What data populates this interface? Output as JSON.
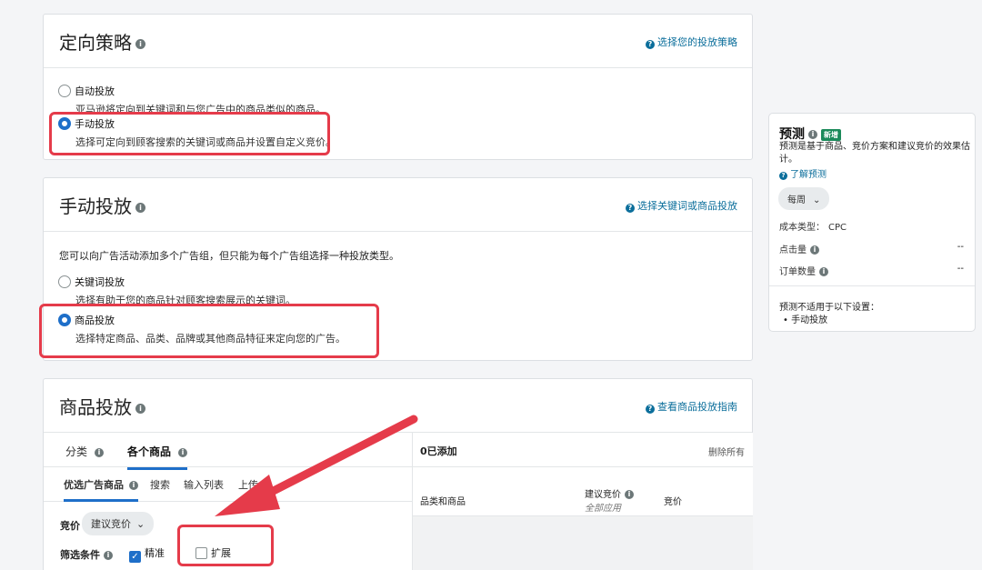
{
  "strategy": {
    "title": "定向策略",
    "help_link": "选择您的投放策略",
    "options": [
      {
        "label": "自动投放",
        "desc": "亚马逊将定向到关键词和与您广告中的商品类似的商品。",
        "selected": false
      },
      {
        "label": "手动投放",
        "desc": "选择可定向到顾客搜索的关键词或商品并设置自定义竞价。",
        "selected": true
      }
    ]
  },
  "manual": {
    "title": "手动投放",
    "help_link": "选择关键词或商品投放",
    "note": "您可以向广告活动添加多个广告组，但只能为每个广告组选择一种投放类型。",
    "options": [
      {
        "label": "关键词投放",
        "desc": "选择有助于您的商品针对顾客搜索展示的关键词。",
        "selected": false
      },
      {
        "label": "商品投放",
        "desc": "选择特定商品、品类、品牌或其他商品特征来定向您的广告。",
        "selected": true
      }
    ]
  },
  "product_targeting": {
    "title": "商品投放",
    "help_link": "查看商品投放指南",
    "tabs": [
      "分类",
      "各个商品"
    ],
    "subtabs": [
      "优选广告商品",
      "搜索",
      "输入列表",
      "上传"
    ],
    "bid_label": "竞价",
    "bid_value": "建议竞价",
    "filter_label": "筛选条件",
    "filter_exact": "精准",
    "filter_expand": "扩展",
    "added_label": "0已添加",
    "remove_all": "删除所有",
    "col_product": "品类和商品",
    "col_suggested": "建议竞价",
    "col_apply_all": "全部应用",
    "col_bid": "竞价"
  },
  "forecast": {
    "title": "预测",
    "badge": "新增",
    "desc": "预测是基于商品、竞价方案和建议竞价的效果估计。",
    "learn_more": "了解预测",
    "period": "每周",
    "cost_type_label": "成本类型：",
    "cost_type_value": "CPC",
    "clicks_label": "点击量",
    "clicks_value": "--",
    "orders_label": "订单数量",
    "orders_value": "--",
    "not_applicable": "预测不适用于以下设置：",
    "not_applicable_item": "手动投放"
  },
  "colors": {
    "accent": "#1e6fc9",
    "link": "#0b6e9b",
    "highlight": "#e53b4a",
    "badge": "#1b8a5a"
  }
}
